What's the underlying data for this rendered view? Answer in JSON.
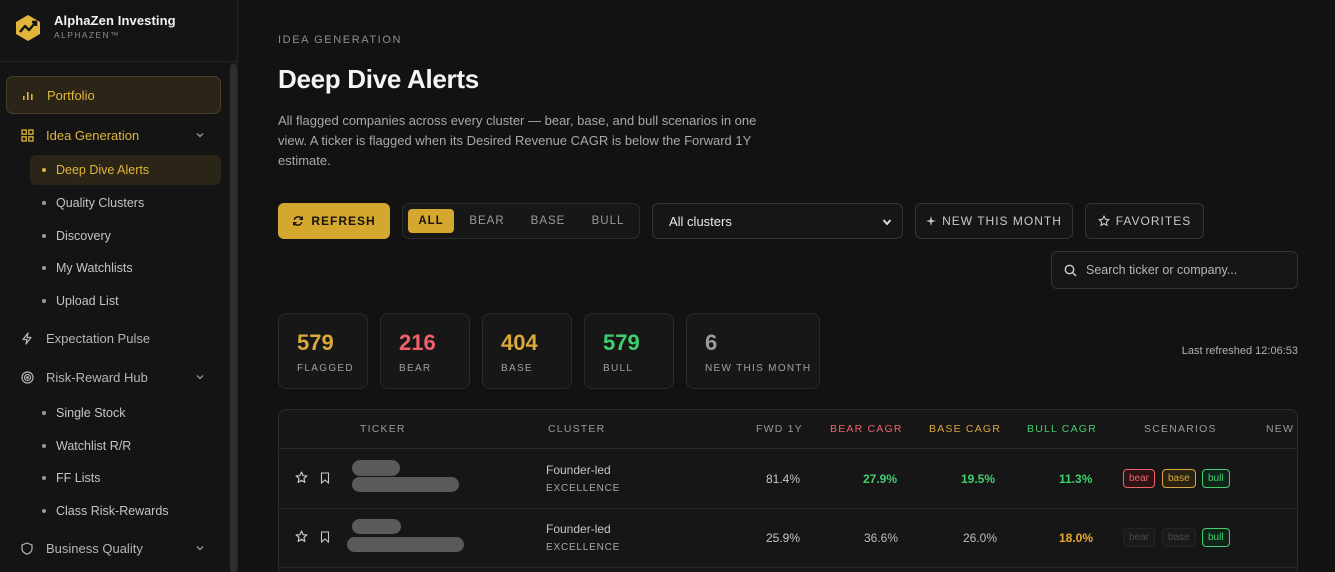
{
  "brand": {
    "name": "AlphaZen Investing",
    "sub": "ALPHAZEN™"
  },
  "sidebar": {
    "portfolio": "Portfolio",
    "idea_generation": "Idea Generation",
    "idea_sub": [
      "Deep Dive Alerts",
      "Quality Clusters",
      "Discovery",
      "My Watchlists",
      "Upload List"
    ],
    "expectation_pulse": "Expectation Pulse",
    "risk_reward_hub": "Risk-Reward Hub",
    "rr_sub": [
      "Single Stock",
      "Watchlist R/R",
      "FF Lists",
      "Class Risk-Rewards"
    ],
    "business_quality": "Business Quality"
  },
  "header": {
    "eyebrow": "IDEA GENERATION",
    "title": "Deep Dive Alerts",
    "description": "All flagged companies across every cluster — bear, base, and bull scenarios in one view. A ticker is flagged when its Desired Revenue CAGR is below the Forward 1Y estimate."
  },
  "toolbar": {
    "refresh": "REFRESH",
    "segments": [
      "ALL",
      "BEAR",
      "BASE",
      "BULL"
    ],
    "active_segment": "ALL",
    "cluster_select": "All clusters",
    "new_this_month": "NEW THIS MONTH",
    "favorites": "FAVORITES",
    "search_placeholder": "Search ticker or company..."
  },
  "stats": [
    {
      "value": "579",
      "label": "FLAGGED",
      "color": "#d9a93a"
    },
    {
      "value": "216",
      "label": "BEAR",
      "color": "#f0616b"
    },
    {
      "value": "404",
      "label": "BASE",
      "color": "#d9a93a"
    },
    {
      "value": "579",
      "label": "BULL",
      "color": "#3fcf6e"
    },
    {
      "value": "6",
      "label": "NEW THIS MONTH",
      "color": "#9a9a9a"
    }
  ],
  "last_refreshed": "Last refreshed 12:06:53",
  "table": {
    "columns": [
      "TICKER",
      "CLUSTER",
      "FWD 1Y",
      "BEAR CAGR",
      "BASE CAGR",
      "BULL CAGR",
      "SCENARIOS",
      "NEW"
    ],
    "rows": [
      {
        "cluster_name": "Founder-led",
        "cluster_tag": "EXCELLENCE",
        "fwd": "81.4%",
        "bear": "27.9%",
        "base": "19.5%",
        "bull": "11.3%",
        "scen_bear": "bear",
        "scen_base": "base",
        "scen_bull": "bull"
      },
      {
        "cluster_name": "Founder-led",
        "cluster_tag": "EXCELLENCE",
        "fwd": "25.9%",
        "bear": "36.6%",
        "base": "26.0%",
        "bull": "18.0%",
        "scen_bear": "bear",
        "scen_base": "base",
        "scen_bull": "bull"
      }
    ]
  },
  "colors": {
    "accent": "#d4a82e",
    "bear": "#f0616b",
    "base": "#d9a93a",
    "bull": "#3fcf6e"
  }
}
